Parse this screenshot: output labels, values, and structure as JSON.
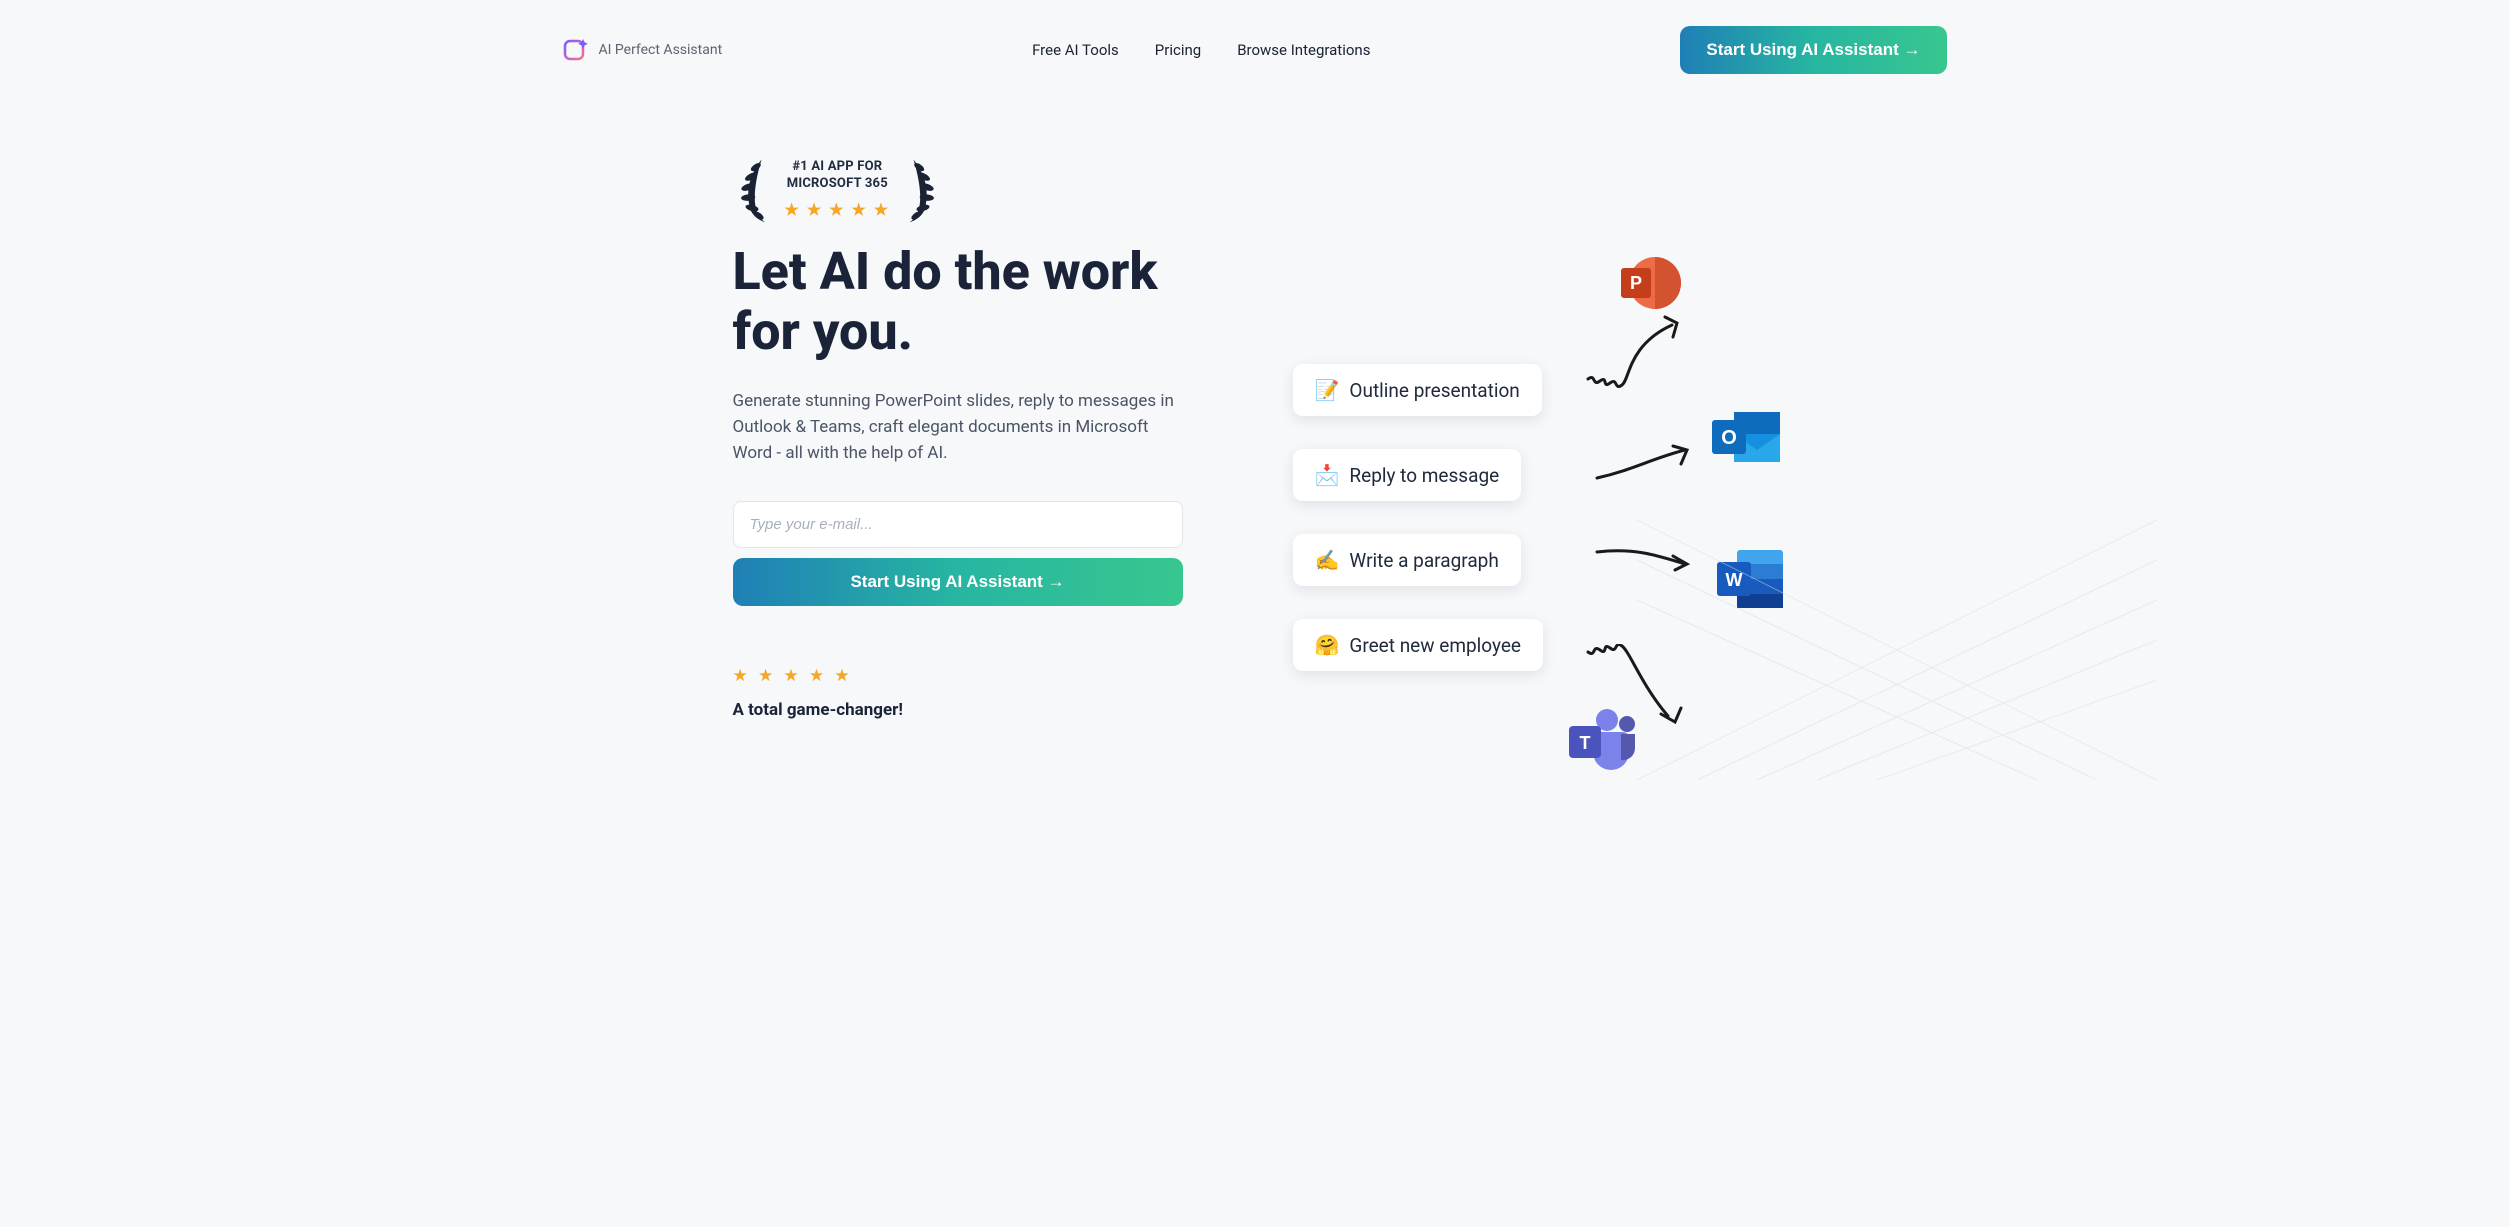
{
  "brand": {
    "name": "AI Perfect Assistant"
  },
  "nav": {
    "links": [
      {
        "label": "Free AI Tools"
      },
      {
        "label": "Pricing"
      },
      {
        "label": "Browse Integrations"
      }
    ],
    "cta": "Start Using AI Assistant →"
  },
  "award": {
    "line1": "#1 AI APP FOR",
    "line2": "MICROSOFT 365",
    "stars": "★ ★ ★ ★ ★"
  },
  "hero": {
    "title": "Let AI do the work for you.",
    "subtitle": "Generate stunning PowerPoint slides, reply to messages in Outlook & Teams, craft elegant documents in Microsoft Word - all with the help of AI.",
    "email_placeholder": "Type your e-mail...",
    "cta": "Start Using AI Assistant →"
  },
  "review": {
    "stars": "★ ★ ★ ★ ★",
    "quote": "A total game-changer!"
  },
  "chips": [
    {
      "emoji": "📝",
      "label": "Outline presentation"
    },
    {
      "emoji": "📩",
      "label": "Reply to message"
    },
    {
      "emoji": "✍️",
      "label": "Write a paragraph"
    },
    {
      "emoji": "🤗",
      "label": "Greet new employee"
    }
  ],
  "apps": [
    {
      "name": "PowerPoint",
      "letter": "P",
      "color": "#d24726"
    },
    {
      "name": "Outlook",
      "letter": "O",
      "color": "#0f6cbd"
    },
    {
      "name": "Word",
      "letter": "W",
      "color": "#185abd"
    },
    {
      "name": "Teams",
      "letter": "T",
      "color": "#5558af"
    }
  ]
}
